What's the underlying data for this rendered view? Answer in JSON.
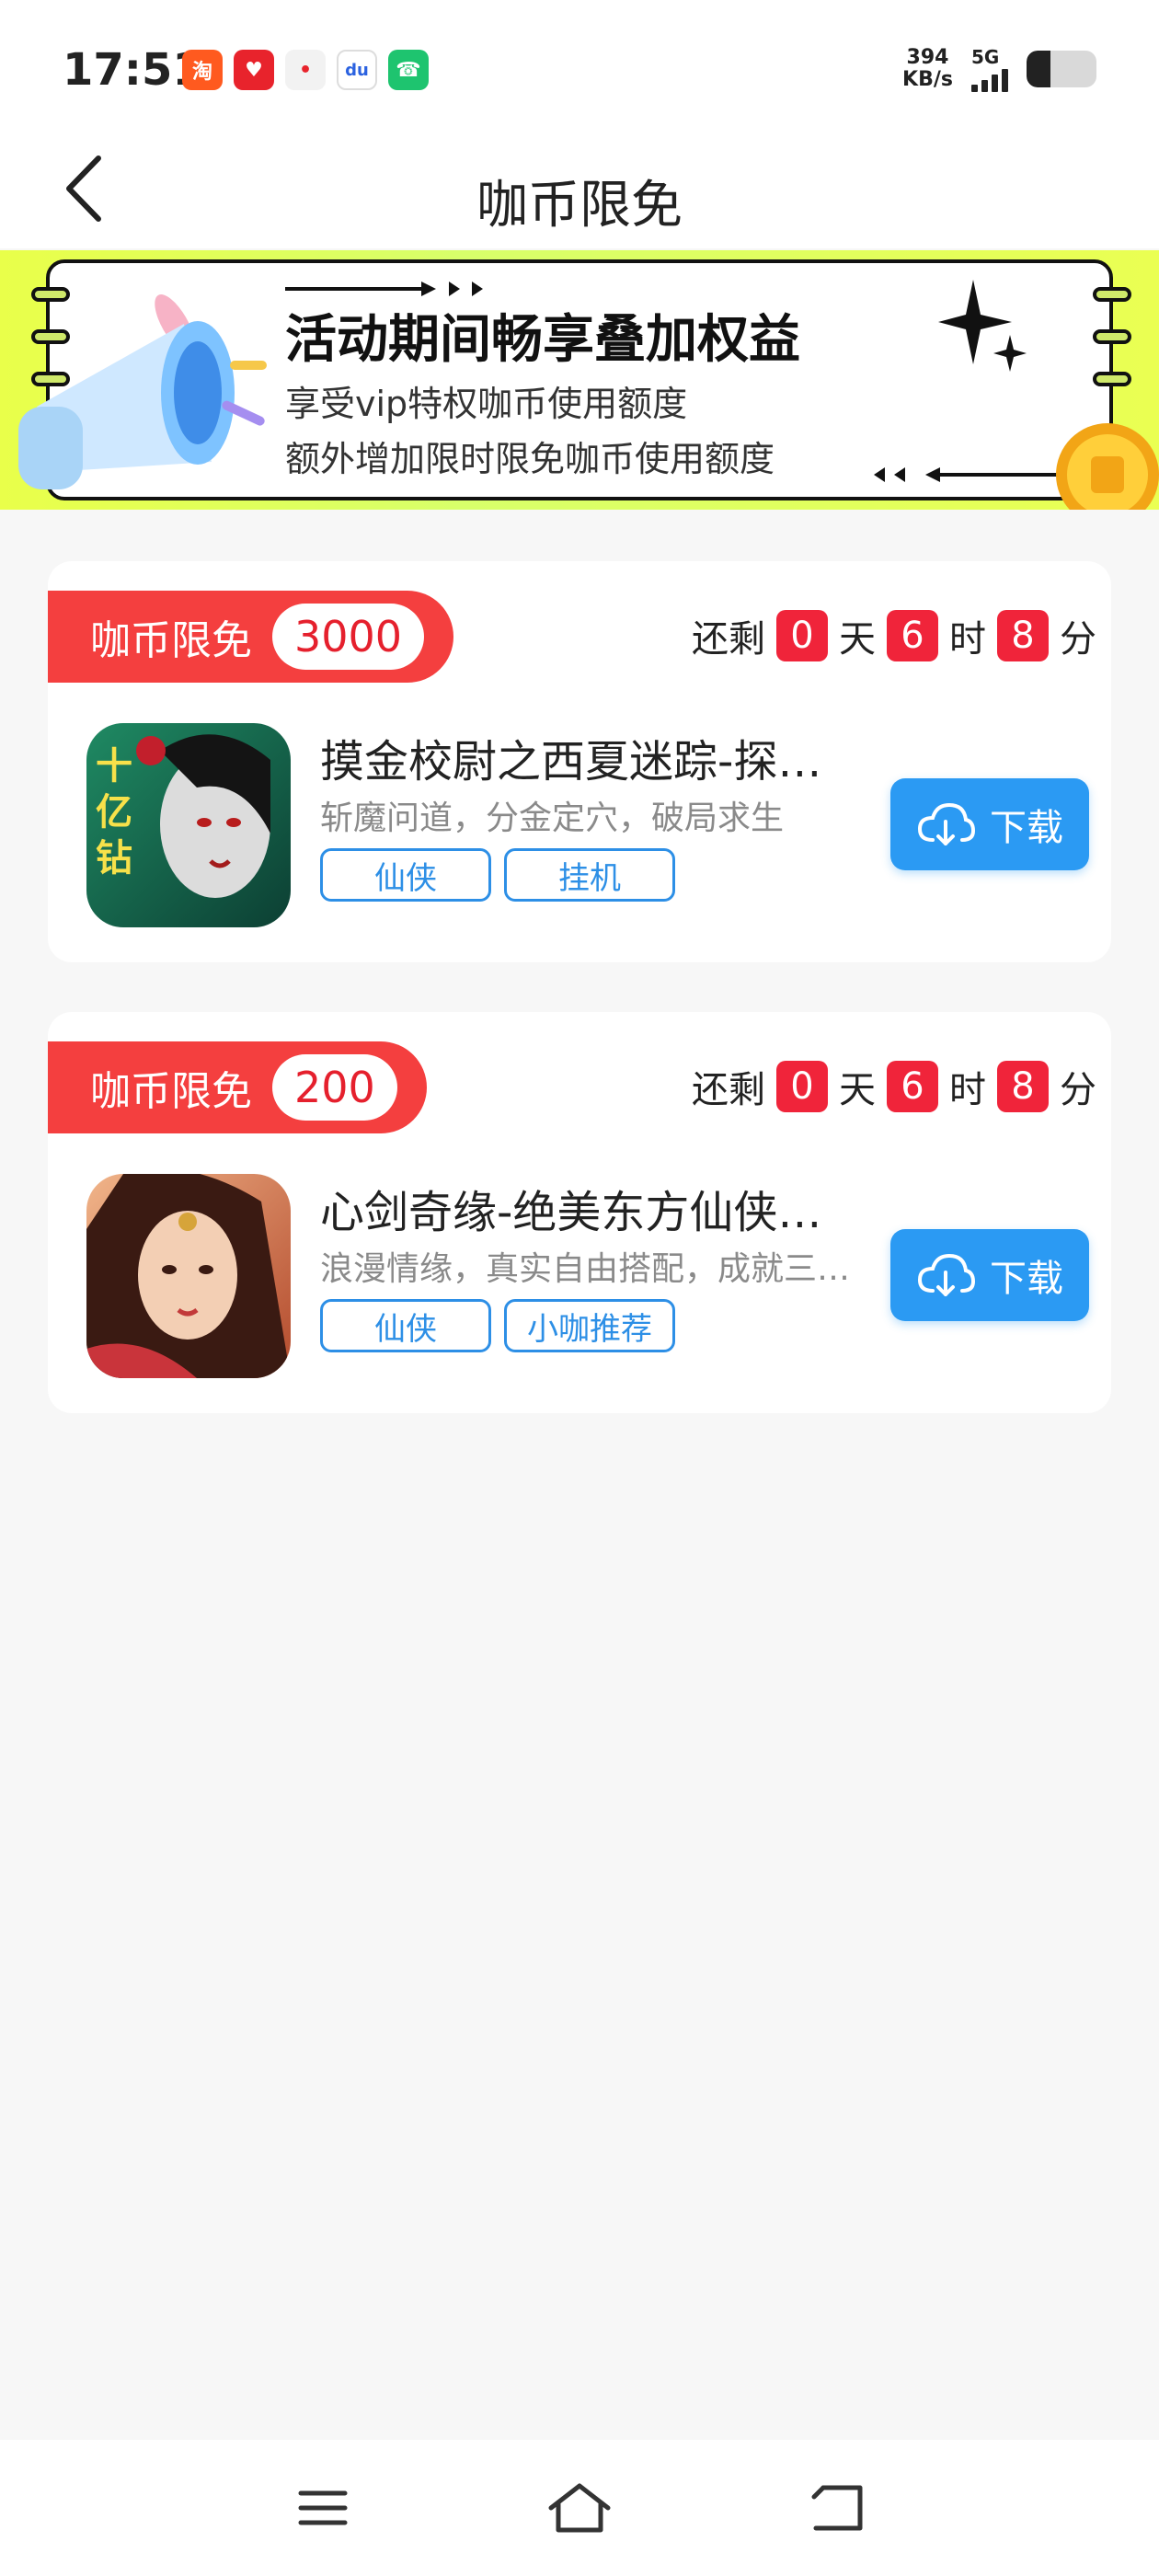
{
  "status_bar": {
    "time": "17:51",
    "net_speed_value": "394",
    "net_speed_unit": "KB/s",
    "network": "5G",
    "apps": [
      {
        "name": "taobao-app-icon",
        "glyph": "淘",
        "color": "#ff5a1f"
      },
      {
        "name": "redheart-app-icon",
        "glyph": "♥",
        "color": "#e8232c"
      },
      {
        "name": "map-pin-app-icon",
        "glyph": "•",
        "color": "#f2f2f2"
      },
      {
        "name": "baidu-app-icon",
        "glyph": "du",
        "color": "#ffffff"
      },
      {
        "name": "phone-app-icon",
        "glyph": "☎",
        "color": "#1ec46f"
      }
    ]
  },
  "header": {
    "title": "咖币限免"
  },
  "banner": {
    "title": "活动期间畅享叠加权益",
    "line1": "享受vip特权咖币使用额度",
    "line2": "额外增加限时限免咖币使用额度"
  },
  "cards": [
    {
      "tag_label": "咖币限免",
      "tag_amount": "3000",
      "countdown": {
        "prefix": "还剩",
        "days": "0",
        "day_unit": "天",
        "hours": "6",
        "hour_unit": "时",
        "minutes": "8",
        "minute_unit": "分"
      },
      "game_name": "摸金校尉之西夏迷踪-探…",
      "game_desc": "斩魔问道，分金定穴，破局求生",
      "tags": [
        "仙侠",
        "挂机"
      ],
      "download_label": "下载"
    },
    {
      "tag_label": "咖币限免",
      "tag_amount": "200",
      "countdown": {
        "prefix": "还剩",
        "days": "0",
        "day_unit": "天",
        "hours": "6",
        "hour_unit": "时",
        "minutes": "8",
        "minute_unit": "分"
      },
      "game_name": "心剑奇缘-绝美东方仙侠…",
      "game_desc": "浪漫情缘，真实自由搭配，成就三…",
      "tags": [
        "仙侠",
        "小咖推荐"
      ],
      "download_label": "下载"
    }
  ],
  "game1_icon_text": "十亿钻",
  "colors": {
    "accent_red": "#f43f3f",
    "count_red": "#f0243a",
    "download_blue": "#2b9af3",
    "chip_blue": "#2d8fe6",
    "banner_yellow": "#e9ff4a"
  },
  "nav_bar": {
    "items": [
      {
        "name": "menu-icon"
      },
      {
        "name": "home-icon"
      },
      {
        "name": "back-nav-icon"
      }
    ]
  }
}
